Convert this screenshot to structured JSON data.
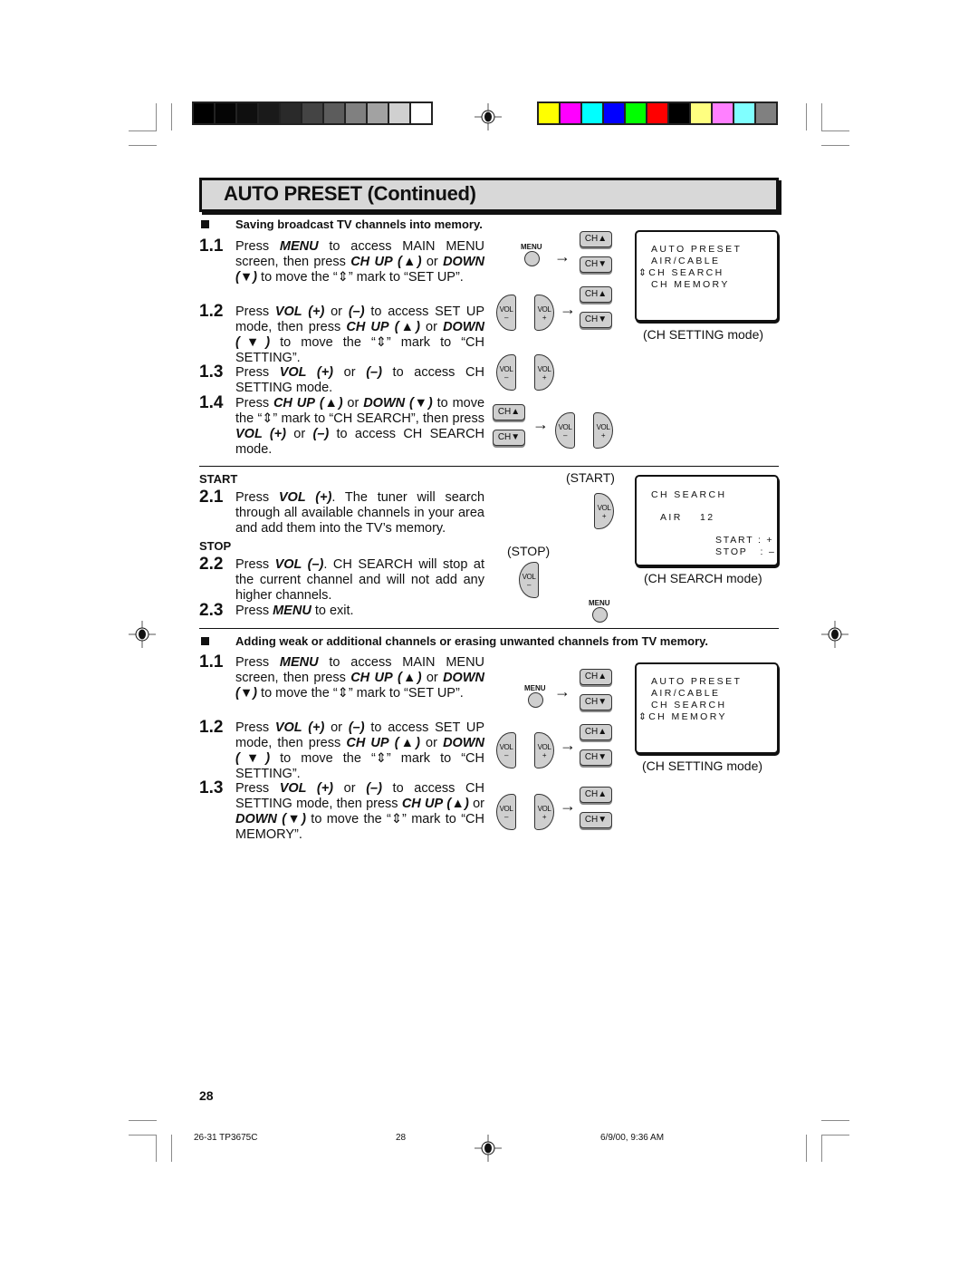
{
  "print_marks": {
    "grayscale_bar": [
      "#000000",
      "#050505",
      "#0f0f0f",
      "#1a1a1a",
      "#2a2a2a",
      "#444444",
      "#5c5c5c",
      "#808080",
      "#a2a2a2",
      "#d0d0d0",
      "#ffffff"
    ],
    "color_bar": [
      "#ffff00",
      "#ff00ff",
      "#00ffff",
      "#0000ff",
      "#00ff00",
      "#ff0000",
      "#000000",
      "#ffff80",
      "#ff80ff",
      "#80ffff",
      "#808080"
    ]
  },
  "header": {
    "title": "AUTO PRESET (Continued)"
  },
  "section1": {
    "heading": "Saving broadcast TV channels into memory.",
    "steps": [
      {
        "num": "1.1",
        "html": "Press <b>MENU</b> to access MAIN MENU screen, then press <b>CH UP</b> <b>(▲)</b> or <b>DOWN</b> <b>(▼)</b> to move the “⇕” mark to “SET UP”."
      },
      {
        "num": "1.2",
        "html": "Press <b>VOL (+)</b> or <b>(–)</b> to access SET UP mode, then press <b>CH UP</b> <b>(▲)</b> or <b>DOWN</b> <b>(▼)</b> to move the “⇕” mark to “CH SETTING”."
      },
      {
        "num": "1.3",
        "html": "Press <b>VOL (+)</b> or <b>(–)</b> to access CH SETTING mode."
      },
      {
        "num": "1.4",
        "html": "Press <b>CH UP</b> <b>(▲)</b> or <b>DOWN</b> <b>(▼)</b> to move the “⇕” mark to “CH SEARCH”, then press <b>VOL (+)</b> or <b>(–)</b> to access CH SEARCH mode."
      }
    ],
    "screen": {
      "lines": [
        "AUTO PRESET",
        "AIR/CABLE",
        "⇕CH SEARCH",
        "CH MEMORY"
      ],
      "caption": "(CH SETTING mode)"
    }
  },
  "section2": {
    "start_label": "START",
    "stop_label": "STOP",
    "steps": [
      {
        "num": "2.1",
        "html": "Press <b>VOL (+)</b>. The tuner will search through all available channels in your area and add them into the TV’s memory."
      },
      {
        "num": "2.2",
        "html": "Press <b>VOL (–)</b>. CH SEARCH will stop at the current channel and will not add any higher channels."
      },
      {
        "num": "2.3",
        "html": "Press <b>MENU</b> to exit."
      }
    ],
    "start_caption": "(START)",
    "stop_caption": "(STOP)",
    "screen": {
      "title": "CH SEARCH",
      "band": "AIR",
      "channel": "12",
      "start_hint": "START : +",
      "stop_hint": "STOP   : –",
      "caption": "(CH SEARCH mode)"
    }
  },
  "section3": {
    "heading": "Adding weak or additional channels or erasing unwanted channels from TV memory.",
    "steps": [
      {
        "num": "1.1",
        "html": "Press <b>MENU</b> to access MAIN MENU screen, then press <b>CH UP</b> <b>(▲)</b> or <b>DOWN</b> <b>(▼)</b> to move the “⇕” mark to “SET UP”."
      },
      {
        "num": "1.2",
        "html": "Press <b>VOL (+)</b> or <b>(–)</b> to access SET UP mode, then press <b>CH UP</b> <b>(▲)</b> or <b>DOWN</b> <b>(▼)</b> to move the “⇕” mark to “CH SETTING”."
      },
      {
        "num": "1.3",
        "html": "Press <b>VOL (+)</b> or <b>(–)</b> to access CH SETTING mode, then press <b>CH UP</b> <b>(▲)</b> or <b>DOWN</b> <b>(▼)</b> to move the “⇕” mark to “CH MEMORY”."
      }
    ],
    "screen": {
      "lines": [
        "AUTO PRESET",
        "AIR/CABLE",
        "CH SEARCH",
        "⇕CH MEMORY"
      ],
      "caption": "(CH SETTING mode)"
    }
  },
  "buttons": {
    "menu": "MENU",
    "ch_up": "CH▲",
    "ch_down": "CH▼",
    "vol": "VOL",
    "minus": "–",
    "plus": "+",
    "arrow": "→"
  },
  "page_number": "28",
  "footer": {
    "job": "26-31 TP3675C",
    "page": "28",
    "timestamp": "6/9/00, 9:36 AM"
  }
}
